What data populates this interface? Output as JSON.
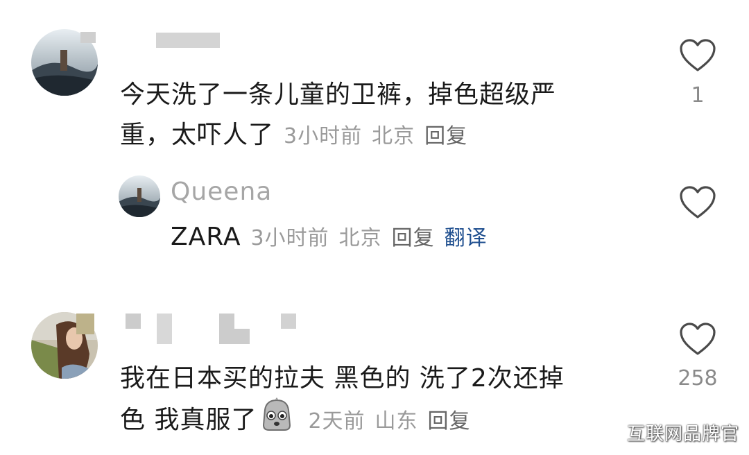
{
  "comments": [
    {
      "text_line1": "今天洗了一条儿童的卫裤，掉色超级严",
      "text_line2": "重，太吓人了",
      "time": "3小时前",
      "location": "北京",
      "reply_label": "回复",
      "like_count": "1",
      "reply": {
        "username": "Queena",
        "text": "ZARA",
        "time": "3小时前",
        "location": "北京",
        "reply_label": "回复",
        "translate_label": "翻译"
      }
    },
    {
      "text_line1": "我在日本买的拉夫 黑色的 洗了2次还掉",
      "text_line2": "色 我真服了",
      "emoji": "crying-face-emoji",
      "time": "2天前",
      "location": "山东",
      "reply_label": "回复",
      "like_count": "258"
    }
  ],
  "watermark": "互联网品牌官",
  "colors": {
    "text": "#1a1a1a",
    "meta": "#9a9a9a",
    "translate": "#1f4f8f",
    "like_outline": "#4a4a4a"
  }
}
